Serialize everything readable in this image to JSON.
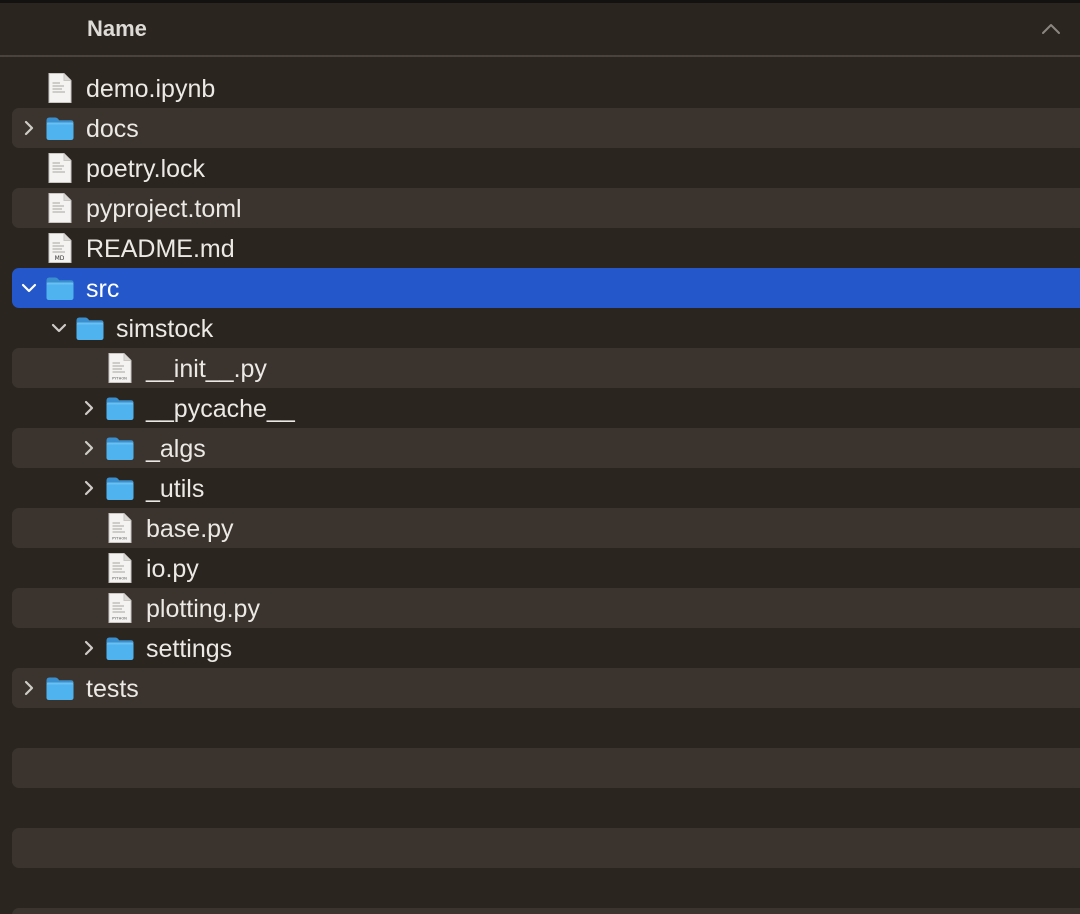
{
  "header": {
    "column_name": "Name",
    "sort_direction": "ascending"
  },
  "colors": {
    "background": "#2b2520",
    "alt_row": "#3b342e",
    "selection": "#2457c9",
    "folder": "#4fb3ef",
    "text": "#ece9e5"
  },
  "rows": [
    {
      "name": "demo.ipynb",
      "kind": "document",
      "icon": "document-icon",
      "depth": 0,
      "disclosure": "none"
    },
    {
      "name": "docs",
      "kind": "folder",
      "icon": "folder-icon",
      "depth": 0,
      "disclosure": "collapsed"
    },
    {
      "name": "poetry.lock",
      "kind": "document",
      "icon": "document-icon",
      "depth": 0,
      "disclosure": "none"
    },
    {
      "name": "pyproject.toml",
      "kind": "document",
      "icon": "document-icon",
      "depth": 0,
      "disclosure": "none"
    },
    {
      "name": "README.md",
      "kind": "document",
      "icon": "markdown-file-icon",
      "depth": 0,
      "disclosure": "none",
      "badge": "MD"
    },
    {
      "name": "src",
      "kind": "folder",
      "icon": "folder-icon",
      "depth": 0,
      "disclosure": "expanded",
      "selected": true
    },
    {
      "name": "simstock",
      "kind": "folder",
      "icon": "folder-icon",
      "depth": 1,
      "disclosure": "expanded"
    },
    {
      "name": "__init__.py",
      "kind": "python",
      "icon": "python-file-icon",
      "depth": 2,
      "disclosure": "none",
      "badge": "PYTHON"
    },
    {
      "name": "__pycache__",
      "kind": "folder",
      "icon": "folder-icon",
      "depth": 2,
      "disclosure": "collapsed"
    },
    {
      "name": "_algs",
      "kind": "folder",
      "icon": "folder-icon",
      "depth": 2,
      "disclosure": "collapsed"
    },
    {
      "name": "_utils",
      "kind": "folder",
      "icon": "folder-icon",
      "depth": 2,
      "disclosure": "collapsed"
    },
    {
      "name": "base.py",
      "kind": "python",
      "icon": "python-file-icon",
      "depth": 2,
      "disclosure": "none",
      "badge": "PYTHON"
    },
    {
      "name": "io.py",
      "kind": "python",
      "icon": "python-file-icon",
      "depth": 2,
      "disclosure": "none",
      "badge": "PYTHON"
    },
    {
      "name": "plotting.py",
      "kind": "python",
      "icon": "python-file-icon",
      "depth": 2,
      "disclosure": "none",
      "badge": "PYTHON"
    },
    {
      "name": "settings",
      "kind": "folder",
      "icon": "folder-icon",
      "depth": 2,
      "disclosure": "collapsed"
    },
    {
      "name": "tests",
      "kind": "folder",
      "icon": "folder-icon",
      "depth": 0,
      "disclosure": "collapsed"
    }
  ],
  "empty_rows": 6
}
